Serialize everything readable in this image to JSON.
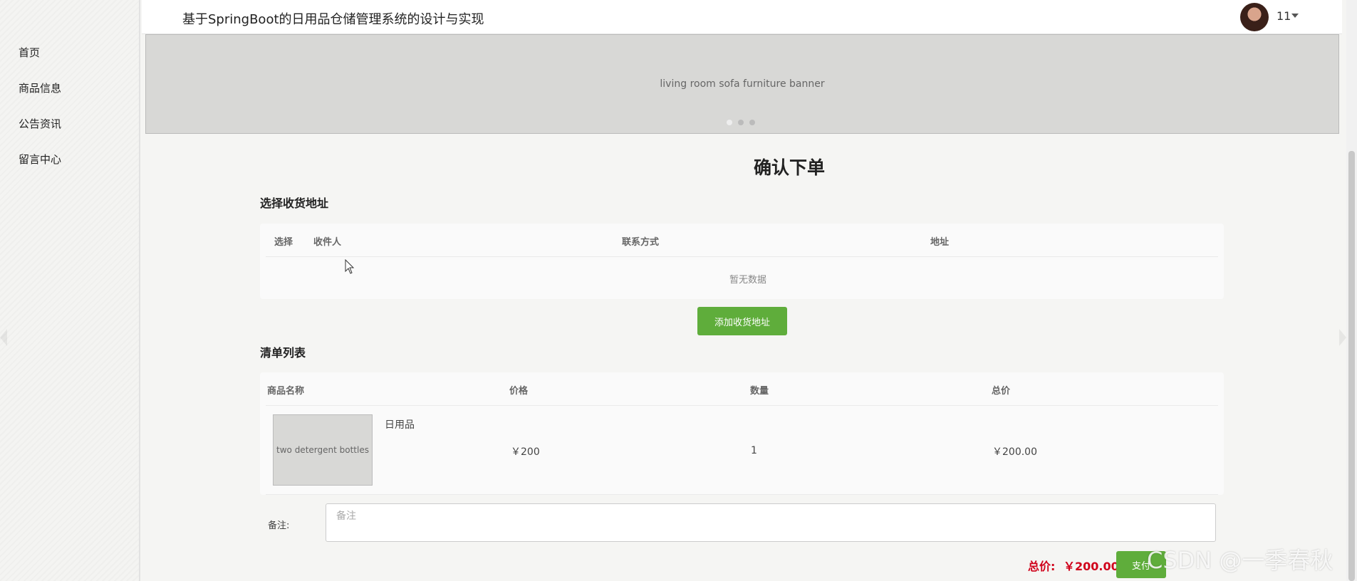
{
  "header": {
    "title": "基于SpringBoot的日用品仓储管理系统的设计与实现",
    "username": "11"
  },
  "sidebar": {
    "items": [
      {
        "label": "首页"
      },
      {
        "label": "商品信息"
      },
      {
        "label": "公告资讯"
      },
      {
        "label": "留言中心"
      }
    ]
  },
  "banner": {
    "image_label": "living room sofa furniture banner"
  },
  "page": {
    "title": "确认下单"
  },
  "address_section": {
    "title": "选择收货地址",
    "columns": [
      "选择",
      "收件人",
      "联系方式",
      "地址"
    ],
    "empty_text": "暂无数据",
    "add_button": "添加收货地址"
  },
  "order_section": {
    "title": "清单列表",
    "columns": [
      "商品名称",
      "价格",
      "数量",
      "总价"
    ],
    "items": [
      {
        "name": "日用品",
        "price": "￥200",
        "quantity": "1",
        "subtotal": "￥200.00",
        "image_label": "two detergent bottles"
      }
    ]
  },
  "remark": {
    "label": "备注:",
    "placeholder": "备注"
  },
  "summary": {
    "total_label": "总价:",
    "total_value": "￥200.00",
    "pay_button": "支付"
  },
  "watermark": "CSDN @一季春秋",
  "colors": {
    "accent_green": "#5fad3b",
    "price_red": "#d0021b"
  }
}
